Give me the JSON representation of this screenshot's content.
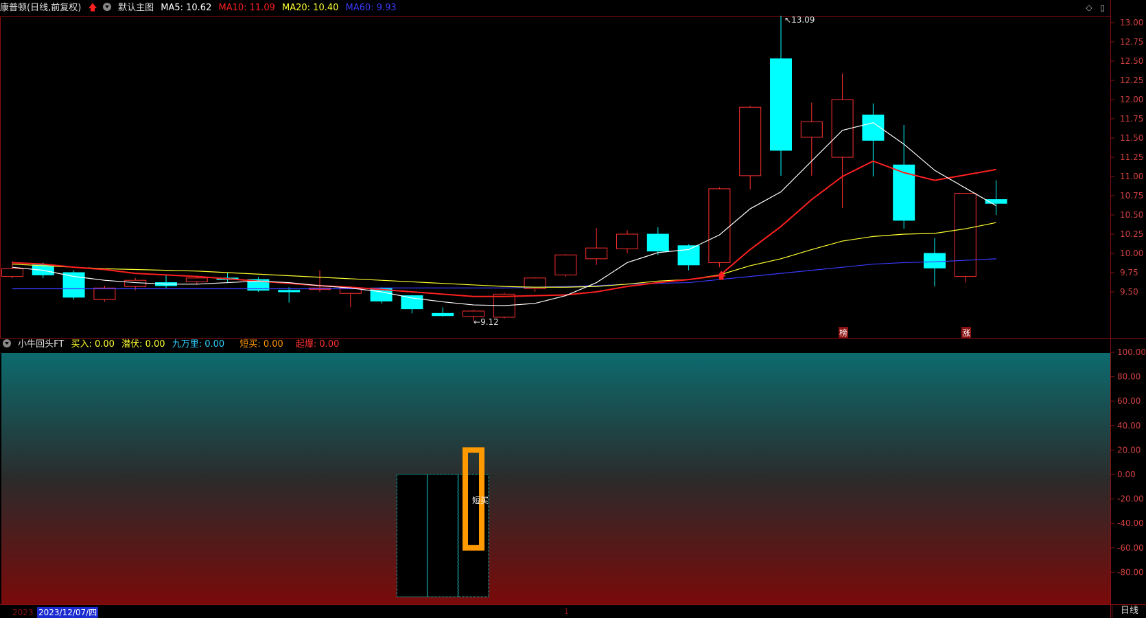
{
  "header": {
    "stock_title": "康普顿(日线,前复权)",
    "template_label": "默认主图",
    "ma5": "MA5: 10.62",
    "ma10": "MA10: 11.09",
    "ma20": "MA20: 10.40",
    "ma60": "MA60: 9.93",
    "colors": {
      "ma5": "#ffffff",
      "ma10": "#ff2020",
      "ma20": "#ffff30",
      "ma60": "#3a3aff"
    }
  },
  "window_controls": {
    "diamond_icon": "◇",
    "restore_icon": "▯"
  },
  "price_axis": {
    "labels": [
      "13.00",
      "12.75",
      "12.50",
      "12.25",
      "12.00",
      "11.75",
      "11.50",
      "11.25",
      "11.00",
      "10.75",
      "10.50",
      "10.25",
      "10.00",
      "9.75",
      "9.50"
    ]
  },
  "annotations": {
    "high": "13.09",
    "low": "9.12",
    "mark1": "榜",
    "mark2": "涨"
  },
  "indicator": {
    "name": "小牛回头FT",
    "buy": "买入: 0.00",
    "lurk": "潜伏: 0.00",
    "nine": "九万里: 0.00",
    "short_buy": "短买: 0.00",
    "takeoff": "起爆: 0.00",
    "colors": {
      "buy": "#ffff30",
      "lurk": "#ffff30",
      "nine": "#30d0ff",
      "short_buy": "#ff9900",
      "takeoff": "#ff3030"
    },
    "bar_label": "短买",
    "axis": [
      "100.00",
      "80.00",
      "60.00",
      "40.00",
      "20.00",
      "0.00",
      "-20.00",
      "-40.00",
      "-60.00",
      "-80.00"
    ]
  },
  "footer": {
    "date_faded": "2023",
    "date": "2023/12/07/四",
    "cursor_mark": "1",
    "period": "日线"
  },
  "chart_data": {
    "type": "candlestick",
    "ylim": [
      9.0,
      13.1
    ],
    "candles": [
      {
        "o": 9.7,
        "c": 9.8,
        "h": 9.9,
        "l": 9.68
      },
      {
        "o": 9.85,
        "c": 9.72,
        "h": 9.88,
        "l": 9.68
      },
      {
        "o": 9.75,
        "c": 9.43,
        "h": 9.78,
        "l": 9.4
      },
      {
        "o": 9.4,
        "c": 9.55,
        "h": 9.58,
        "l": 9.37
      },
      {
        "o": 9.57,
        "c": 9.65,
        "h": 9.68,
        "l": 9.52
      },
      {
        "o": 9.62,
        "c": 9.58,
        "h": 9.72,
        "l": 9.55
      },
      {
        "o": 9.63,
        "c": 9.68,
        "h": 9.71,
        "l": 9.6
      },
      {
        "o": 9.68,
        "c": 9.66,
        "h": 9.75,
        "l": 9.62
      },
      {
        "o": 9.66,
        "c": 9.52,
        "h": 9.69,
        "l": 9.5
      },
      {
        "o": 9.52,
        "c": 9.5,
        "h": 9.56,
        "l": 9.36
      },
      {
        "o": 9.53,
        "c": 9.55,
        "h": 9.78,
        "l": 9.5
      },
      {
        "o": 9.48,
        "c": 9.55,
        "h": 9.56,
        "l": 9.3
      },
      {
        "o": 9.55,
        "c": 9.38,
        "h": 9.56,
        "l": 9.35
      },
      {
        "o": 9.45,
        "c": 9.28,
        "h": 9.46,
        "l": 9.22
      },
      {
        "o": 9.22,
        "c": 9.19,
        "h": 9.3,
        "l": 9.18
      },
      {
        "o": 9.18,
        "c": 9.25,
        "h": 9.27,
        "l": 9.12
      },
      {
        "o": 9.17,
        "c": 9.47,
        "h": 9.49,
        "l": 9.15
      },
      {
        "o": 9.54,
        "c": 9.68,
        "h": 9.69,
        "l": 9.5
      },
      {
        "o": 9.72,
        "c": 9.98,
        "h": 9.99,
        "l": 9.7
      },
      {
        "o": 9.93,
        "c": 10.07,
        "h": 10.33,
        "l": 9.85
      },
      {
        "o": 10.06,
        "c": 10.25,
        "h": 10.3,
        "l": 10.0
      },
      {
        "o": 10.25,
        "c": 10.03,
        "h": 10.34,
        "l": 9.98
      },
      {
        "o": 10.1,
        "c": 9.85,
        "h": 10.12,
        "l": 9.78
      },
      {
        "o": 9.88,
        "c": 10.84,
        "h": 10.86,
        "l": 9.82
      },
      {
        "o": 11.01,
        "c": 11.9,
        "h": 11.92,
        "l": 10.83
      },
      {
        "o": 12.53,
        "c": 11.34,
        "h": 13.09,
        "l": 11.01
      },
      {
        "o": 11.51,
        "c": 11.71,
        "h": 11.96,
        "l": 11.01
      },
      {
        "o": 11.25,
        "c": 12.0,
        "h": 12.34,
        "l": 10.59
      },
      {
        "o": 11.8,
        "c": 11.47,
        "h": 11.95,
        "l": 11.0
      },
      {
        "o": 11.15,
        "c": 10.43,
        "h": 11.67,
        "l": 10.32
      },
      {
        "o": 10.0,
        "c": 9.81,
        "h": 10.2,
        "l": 9.57
      },
      {
        "o": 9.7,
        "c": 10.78,
        "h": 10.78,
        "l": 9.62
      },
      {
        "o": 10.7,
        "c": 10.65,
        "h": 10.95,
        "l": 10.5
      }
    ],
    "ma5": [
      9.82,
      9.78,
      9.7,
      9.65,
      9.62,
      9.6,
      9.6,
      9.62,
      9.64,
      9.62,
      9.58,
      9.55,
      9.5,
      9.42,
      9.37,
      9.33,
      9.32,
      9.35,
      9.45,
      9.62,
      9.88,
      10.01,
      10.05,
      10.24,
      10.58,
      10.8,
      11.2,
      11.6,
      11.7,
      11.42,
      11.08,
      10.85,
      10.62
    ],
    "ma10": [
      9.88,
      9.86,
      9.82,
      9.79,
      9.74,
      9.72,
      9.7,
      9.67,
      9.64,
      9.61,
      9.58,
      9.56,
      9.53,
      9.5,
      9.47,
      9.44,
      9.44,
      9.45,
      9.46,
      9.5,
      9.57,
      9.62,
      9.66,
      9.71,
      10.05,
      10.35,
      10.7,
      11.0,
      11.2,
      11.05,
      10.95,
      11.02,
      11.09
    ],
    "ma20": [
      9.86,
      9.84,
      9.82,
      9.8,
      9.79,
      9.78,
      9.77,
      9.75,
      9.73,
      9.71,
      9.69,
      9.67,
      9.65,
      9.63,
      9.61,
      9.59,
      9.57,
      9.56,
      9.56,
      9.57,
      9.6,
      9.64,
      9.66,
      9.72,
      9.84,
      9.93,
      10.05,
      10.16,
      10.22,
      10.25,
      10.26,
      10.32,
      10.4
    ],
    "ma60": [
      9.54,
      9.54,
      9.54,
      9.54,
      9.54,
      9.54,
      9.54,
      9.54,
      9.54,
      9.54,
      9.54,
      9.54,
      9.55,
      9.55,
      9.55,
      9.55,
      9.55,
      9.56,
      9.57,
      9.58,
      9.6,
      9.61,
      9.62,
      9.66,
      9.7,
      9.74,
      9.78,
      9.82,
      9.86,
      9.88,
      9.89,
      9.91,
      9.93
    ],
    "indicator_bars": [
      {
        "index": 13,
        "top": 0,
        "bottom": -100,
        "style": "outline-cyan"
      },
      {
        "index": 14,
        "top": 0,
        "bottom": -100,
        "style": "outline-cyan"
      },
      {
        "index": 15,
        "top": 20,
        "bottom": -60,
        "style": "orange-hollow"
      }
    ]
  }
}
